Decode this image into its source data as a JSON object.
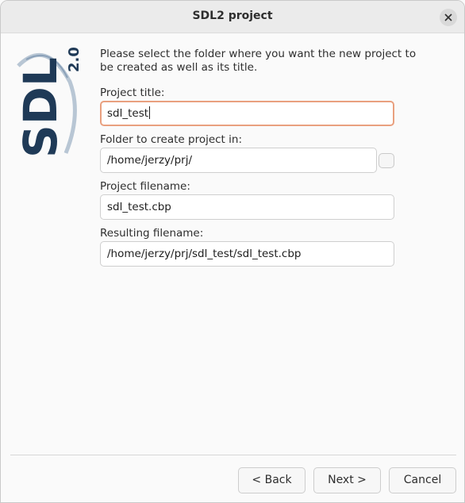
{
  "window": {
    "title": "SDL2 project"
  },
  "logo": {
    "text": "SDL",
    "version": "2.0"
  },
  "intro": "Please select the folder where you want the new project to be created as well as its title.",
  "fields": {
    "project_title": {
      "label": "Project title:",
      "value": "sdl_test"
    },
    "folder": {
      "label": "Folder to create project in:",
      "value": "/home/jerzy/prj/"
    },
    "project_filename": {
      "label": "Project filename:",
      "value": "sdl_test.cbp"
    },
    "resulting_filename": {
      "label": "Resulting filename:",
      "value": "/home/jerzy/prj/sdl_test/sdl_test.cbp"
    }
  },
  "buttons": {
    "back": "< Back",
    "next": "Next >",
    "cancel": "Cancel"
  },
  "colors": {
    "focus_border": "#e9a07f",
    "logo_blue": "#1f3a57"
  }
}
